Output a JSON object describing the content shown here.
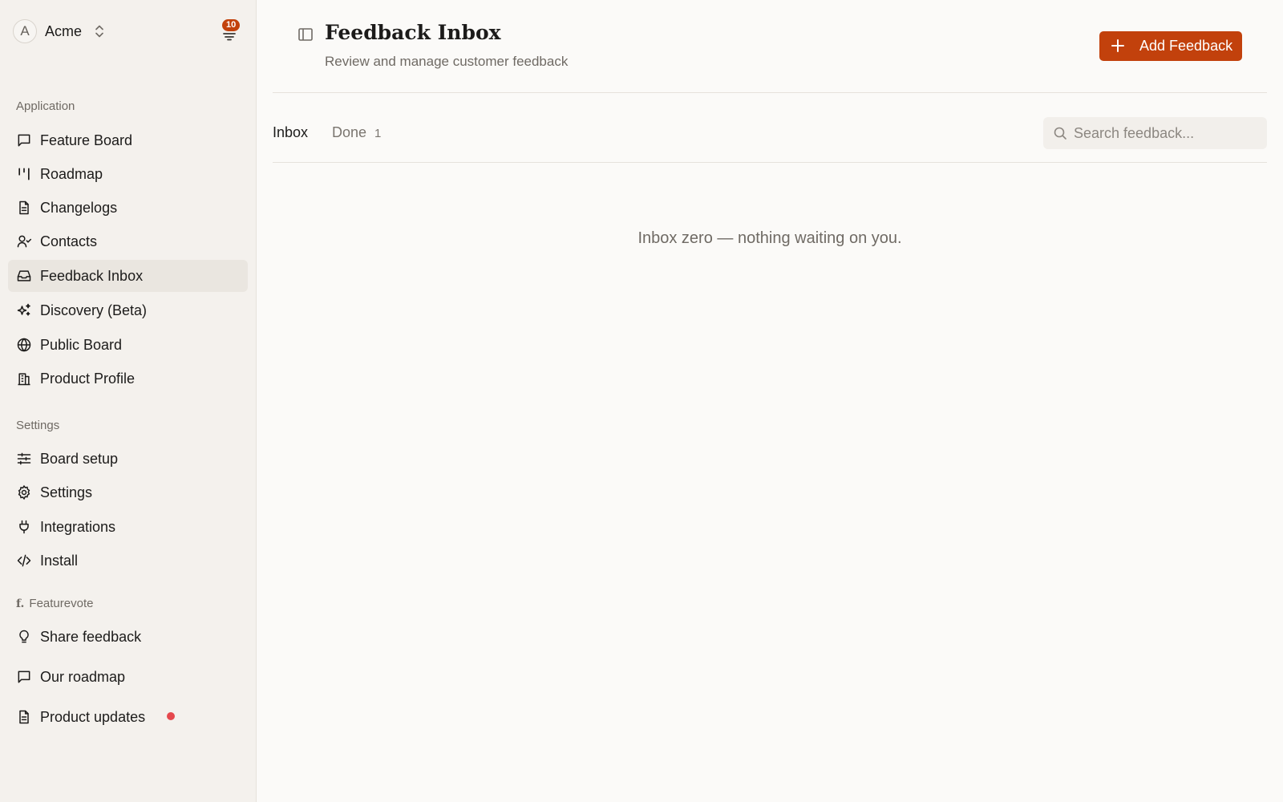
{
  "workspace": {
    "initial": "A",
    "name": "Acme"
  },
  "notifications": {
    "count": "10"
  },
  "sidebar": {
    "application_label": "Application",
    "application_items": [
      {
        "label": "Feature Board",
        "icon": "message-square-icon"
      },
      {
        "label": "Roadmap",
        "icon": "roadmap-icon"
      },
      {
        "label": "Changelogs",
        "icon": "file-text-icon"
      },
      {
        "label": "Contacts",
        "icon": "user-check-icon"
      },
      {
        "label": "Feedback Inbox",
        "icon": "inbox-icon",
        "active": true
      },
      {
        "label": "Discovery (Beta)",
        "icon": "sparkles-icon"
      },
      {
        "label": "Public Board",
        "icon": "globe-icon"
      },
      {
        "label": "Product Profile",
        "icon": "building-icon"
      }
    ],
    "settings_label": "Settings",
    "settings_items": [
      {
        "label": "Board setup",
        "icon": "sliders-icon"
      },
      {
        "label": "Settings",
        "icon": "gear-icon"
      },
      {
        "label": "Integrations",
        "icon": "plug-icon"
      },
      {
        "label": "Install",
        "icon": "code-icon"
      }
    ],
    "featurevote_logo": "f.",
    "featurevote_label": "Featurevote",
    "featurevote_items": [
      {
        "label": "Share feedback",
        "icon": "lightbulb-icon"
      },
      {
        "label": "Our roadmap",
        "icon": "message-square-icon"
      },
      {
        "label": "Product updates",
        "icon": "file-text-icon",
        "unread_dot_color": "#e5484d"
      }
    ]
  },
  "header": {
    "title": "Feedback Inbox",
    "subtitle": "Review and manage customer feedback",
    "add_button_label": "Add Feedback",
    "accent_color": "#c2410c"
  },
  "tabs": {
    "inbox_label": "Inbox",
    "done_label": "Done",
    "done_count": "1"
  },
  "search": {
    "placeholder": "Search feedback...",
    "value": ""
  },
  "empty_state": "Inbox zero — nothing waiting on you."
}
